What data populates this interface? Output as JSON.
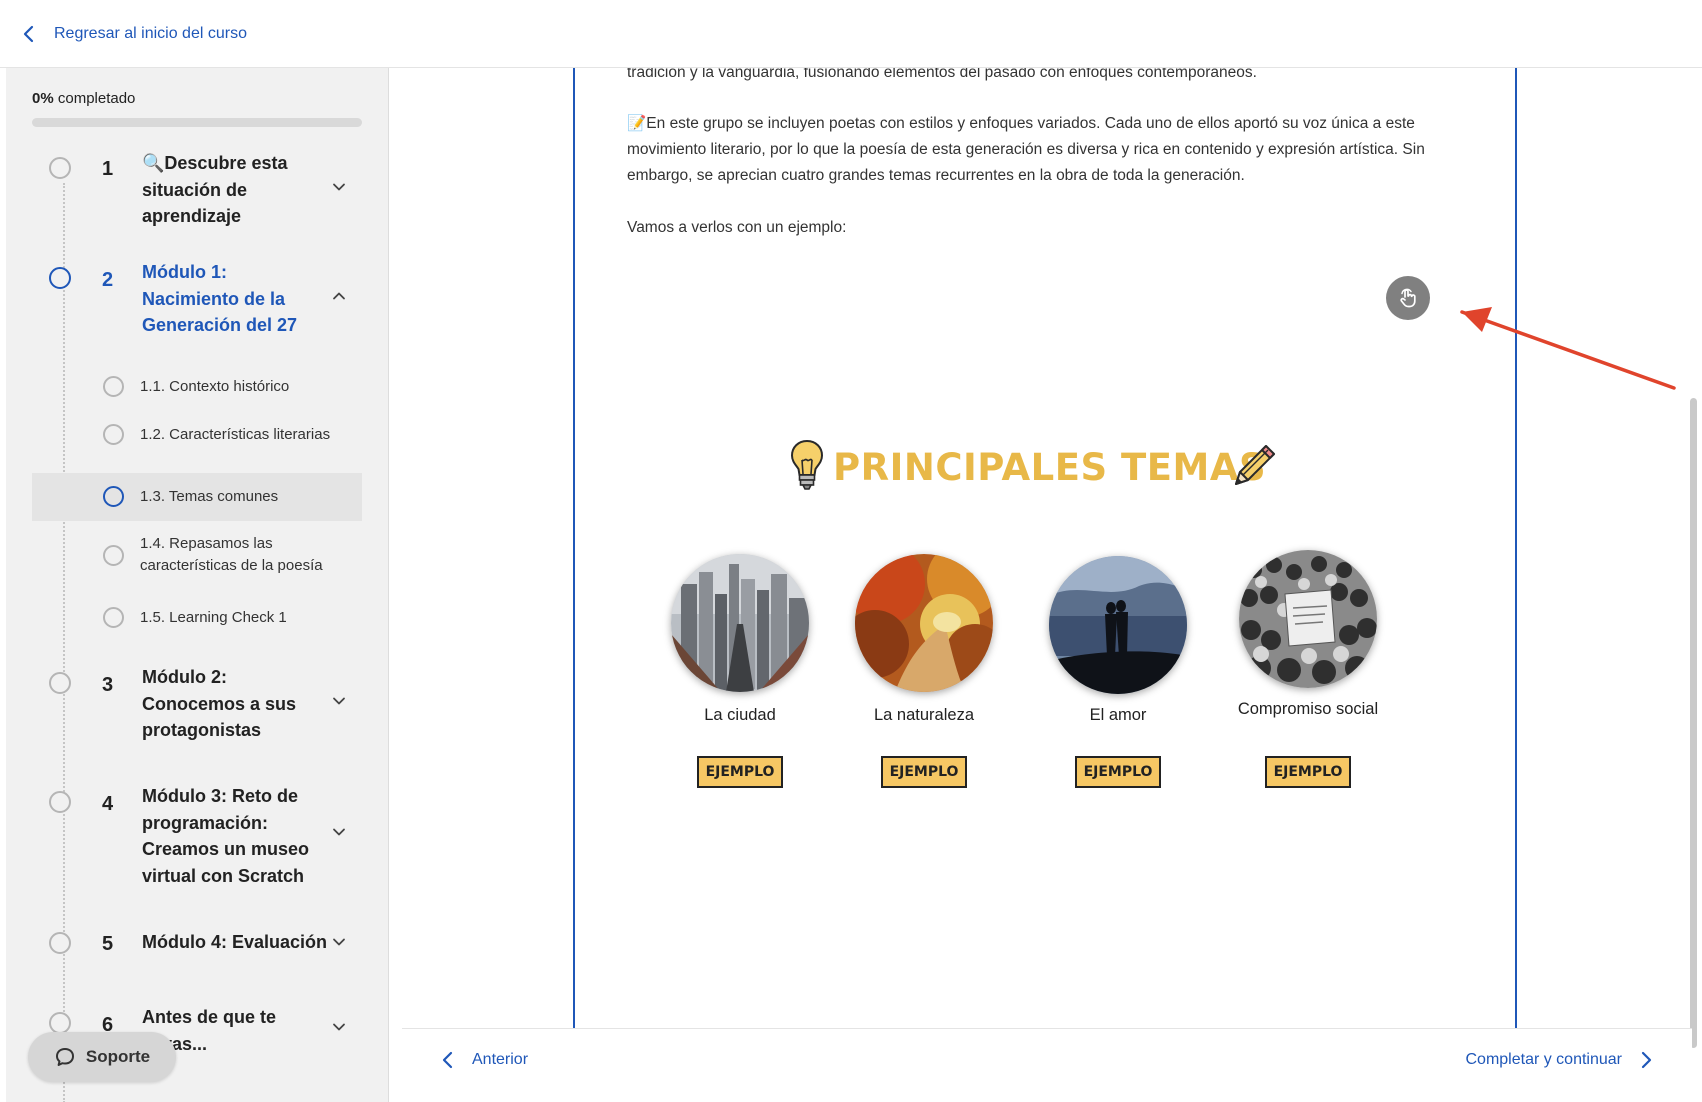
{
  "topbar": {
    "back_label": "Regresar al inicio del curso"
  },
  "sidebar": {
    "progress_percent": "0%",
    "progress_suffix": " completado",
    "progress_value": 0,
    "modules": [
      {
        "number": "1",
        "title": "🔍Descubre esta situación de aprendizaje"
      },
      {
        "number": "2",
        "title": "Módulo 1: Nacimiento de la Generación del 27"
      },
      {
        "number": "3",
        "title": "Módulo 2: Conocemos a sus protagonistas"
      },
      {
        "number": "4",
        "title": "Módulo 3: Reto de programación: Creamos un museo virtual con Scratch"
      },
      {
        "number": "5",
        "title": "Módulo 4: Evaluación"
      },
      {
        "number": "6",
        "title": "Antes de que te vayas..."
      }
    ],
    "lessons": [
      {
        "title": "1.1. Contexto histórico"
      },
      {
        "title": "1.2. Características literarias"
      },
      {
        "title": "1.3. Temas comunes"
      },
      {
        "title": "1.4. Repasamos las características de la poesía"
      },
      {
        "title": "1.5. Learning Check 1"
      }
    ],
    "support_label": "Soporte"
  },
  "content": {
    "paragraph_cut": "tradición y la vanguardia, fusionando elementos del pasado con enfoques contemporáneos.",
    "paragraph_main": "📝En este grupo se incluyen poetas con estilos y enfoques variados. Cada uno de ellos aportó su voz única a este movimiento literario, por lo que la poesía de esta generación es diversa y rica en contenido y expresión artística. Sin embargo, se aprecian cuatro grandes temas recurrentes en la obra de toda la generación.",
    "paragraph_intro": "Vamos a verlos con un ejemplo:",
    "embed_title": "PRINCIPALES TEMAS",
    "themes": [
      {
        "label": "La ciudad",
        "button": "EJEMPLO"
      },
      {
        "label": "La naturaleza",
        "button": "EJEMPLO"
      },
      {
        "label": "El amor",
        "button": "EJEMPLO"
      },
      {
        "label": "Compromiso social",
        "button": "EJEMPLO"
      }
    ]
  },
  "nav": {
    "prev_label": "Anterior",
    "next_label": "Completar y continuar"
  },
  "colors": {
    "accent": "#1f57b8",
    "title_yellow": "#e8b848",
    "button_yellow": "#f6c764",
    "annotation_red": "#e0442c"
  },
  "icons": [
    "chevron-left-icon",
    "chevron-down-icon",
    "chevron-up-icon",
    "chevron-right-icon",
    "chat-bubble-icon",
    "pointer-hand-icon",
    "external-link-icon",
    "lightbulb-icon",
    "pencil-icon",
    "red-arrow-annotation"
  ]
}
